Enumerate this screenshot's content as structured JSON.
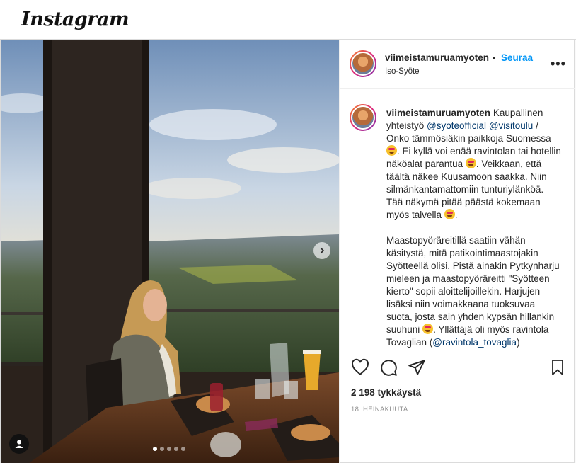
{
  "app": {
    "name": "Instagram"
  },
  "post": {
    "username": "viimeistamuruamyoten",
    "separator": "•",
    "follow_label": "Seuraa",
    "location": "Iso-Syöte",
    "more_icon": "more-horizontal-icon",
    "caption": {
      "p1_a": "Kaupallinen yhteistyö",
      "mention1": "@syoteofficial",
      "mention2": "@visitoulu",
      "p1_b": "/ Onko tämmösiäkin paikkoja Suomessa",
      "p1_c": ". Ei kyllä voi enää ravintolan tai hotellin näköalat parantua",
      "p1_d": ". Veikkaan, että täältä näkee Kuusamoon saakka. Niin silmänkantamattomiin tunturiylänköä. Tää näkymä pitää päästä kokemaan myös talvella",
      "p1_e": ".",
      "p2_a": "Maastopyöräreitillä saatiin vähän käsitystä, mitä patikointimaastojakin Syötteellä olisi. Pistä ainakin Pytkynharju mieleen ja maastopyöräreitti \"Syötteen kierto\" sopii aloittelijoillekin. Harjujen lisäksi niin voimakkaana tuoksuvaa suota, josta sain yhden kypsän hillankin suuhuni",
      "p2_b": ". Yllättäjä oli myös ravintola Tovaglian (",
      "mention3": "@ravintola_tovaglia",
      "p2_c": ")"
    },
    "likes_text": "2 198 tykkäystä",
    "date_text": "18. HEINÄKUUTA",
    "carousel": {
      "total": 5,
      "active_index": 0
    },
    "colors": {
      "follow": "#0095f6",
      "mention": "#00376b",
      "muted": "#8e8e8e"
    }
  }
}
